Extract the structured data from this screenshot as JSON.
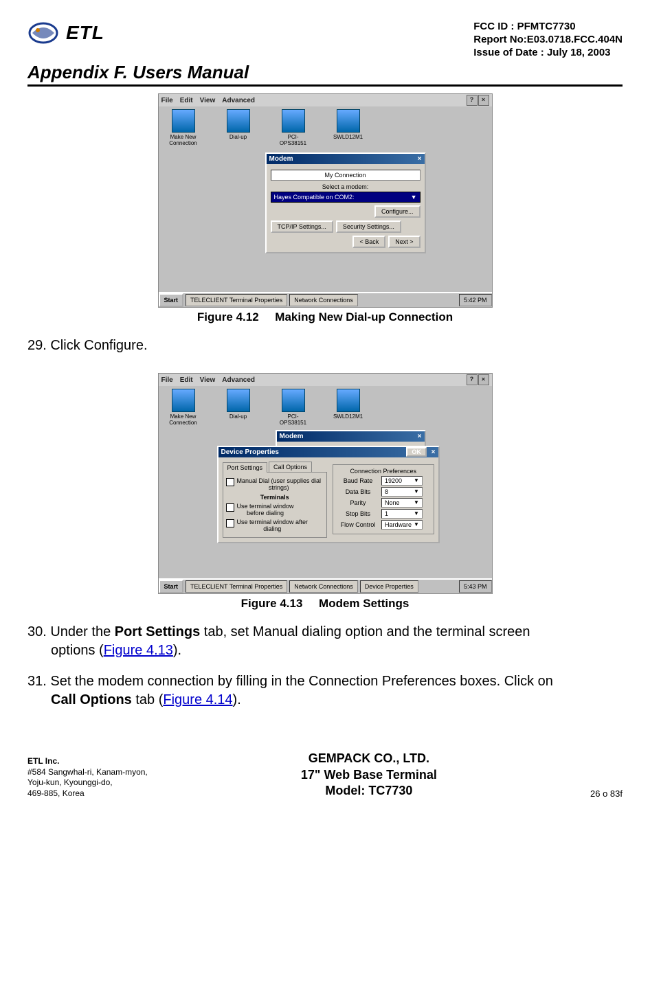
{
  "header": {
    "logo_text": "ETL",
    "meta1": "FCC ID : PFMTC7730",
    "meta2": "Report No:E03.0718.FCC.404N",
    "meta3": "Issue of Date : July 18, 2003"
  },
  "appendix_title": "Appendix F.  Users Manual",
  "figure_12": {
    "menubar": {
      "items": [
        "File",
        "Edit",
        "View",
        "Advanced"
      ]
    },
    "desk_icons": [
      {
        "label": "Make New\nConnection"
      },
      {
        "label": "Dial-up"
      },
      {
        "label": "PCI-\nOPS38151"
      },
      {
        "label": "SWLD12M1"
      }
    ],
    "modal": {
      "title": "Modem",
      "close": "×",
      "line1": "My Connection",
      "line2": "Select a modem:",
      "selected": "Hayes Compatible on COM2:",
      "config_btn": "Configure...",
      "tcp_btn": "TCP/IP Settings...",
      "sec_btn": "Security Settings...",
      "back_btn": "< Back",
      "next_btn": "Next >"
    },
    "taskbar": {
      "start": "Start",
      "app1": "TELECLIENT Terminal Properties",
      "app2": "Network Connections",
      "time": "5:42 PM"
    },
    "caption_label": "Figure 4.12",
    "caption_text": "Making New Dial-up Connection"
  },
  "step_29": "29. Click Configure.",
  "figure_13": {
    "menubar": {
      "items": [
        "File",
        "Edit",
        "View",
        "Advanced"
      ]
    },
    "desk_icons": [
      {
        "label": "Make New\nConnection"
      },
      {
        "label": "Dial-up"
      },
      {
        "label": "PCI-\nOPS38151"
      },
      {
        "label": "SWLD12M1"
      }
    ],
    "modal_back": {
      "title": "Modem",
      "close": "×"
    },
    "modal_front": {
      "title": "Device Properties",
      "ok_btn": "OK",
      "close": "×",
      "tab1": "Port Settings",
      "tab2": "Call Options",
      "manual_dial": "Manual Dial (user supplies dial\nstrings)",
      "terminal_header": "Terminals",
      "term1": "Use terminal window\nbefore dialing",
      "term2": "Use terminal window after\ndialing",
      "conn_pref": "Connection Preferences",
      "rows": [
        {
          "k": "Baud Rate",
          "v": "19200"
        },
        {
          "k": "Data Bits",
          "v": "8"
        },
        {
          "k": "Parity",
          "v": "None"
        },
        {
          "k": "Stop Bits",
          "v": "1"
        },
        {
          "k": "Flow Control",
          "v": "Hardware"
        }
      ]
    },
    "taskbar": {
      "start": "Start",
      "app1": "TELECLIENT Terminal Properties",
      "app2": "Network Connections",
      "app3": "Device Properties",
      "time": "5:43 PM"
    },
    "caption_label": "Figure 4.13",
    "caption_text": "Modem Settings"
  },
  "step_30_pre": "30. Under the ",
  "step_30_bold": "Port Settings",
  "step_30_mid": " tab, set Manual dialing option and the terminal screen",
  "step_30_cont": "options (",
  "step_30_link": "Figure 4.13",
  "step_30_end": ").",
  "step_31_pre": "31. Set the modem connection by filling in the Connection Preferences boxes. Click on",
  "step_31_bold": "Call Options",
  "step_31_mid": " tab (",
  "step_31_link": "Figure 4.14",
  "step_31_end": ").",
  "footer": {
    "l1": "ETL Inc.",
    "l2": "#584 Sangwhal-ri, Kanam-myon,",
    "l3": "Yoju-kun, Kyounggi-do,",
    "l4": "469-885, Korea",
    "c1": "GEMPACK CO., LTD.",
    "c2": "17\" Web Base Terminal",
    "c3": "Model: TC7730",
    "r": "26 o 83f"
  }
}
